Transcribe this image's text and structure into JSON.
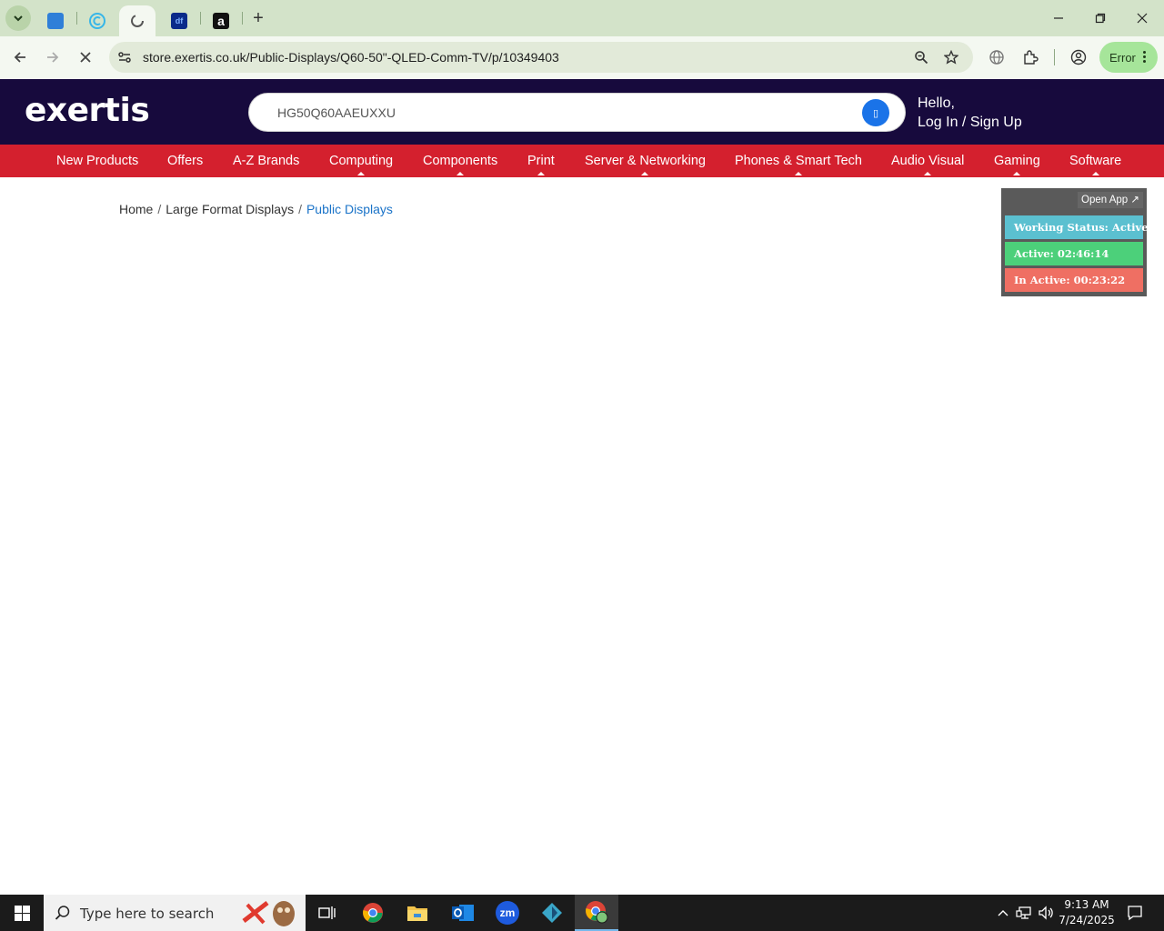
{
  "browser": {
    "tabs": [
      {
        "icon": "tab-favicon-blue-app"
      },
      {
        "icon": "tab-favicon-copyleaks"
      },
      {
        "icon": "tab-favicon-loading",
        "active": true
      },
      {
        "icon": "tab-favicon-df",
        "label": "df"
      },
      {
        "icon": "tab-favicon-amazon",
        "label": "a"
      }
    ],
    "new_tab_label": "+",
    "url": "store.exertis.co.uk/Public-Displays/Q60-50\"-QLED-Comm-TV/p/10349403",
    "error_label": "Error"
  },
  "site": {
    "logo": "exertis",
    "search_value": "HG50Q60AAEUXXU",
    "search_button_glyph": "▯",
    "hello": "Hello,",
    "login": "Log In / Sign Up",
    "nav": [
      {
        "label": "New Products"
      },
      {
        "label": "Offers"
      },
      {
        "label": "A-Z Brands"
      },
      {
        "label": "Computing"
      },
      {
        "label": "Components"
      },
      {
        "label": "Print"
      },
      {
        "label": "Server & Networking"
      },
      {
        "label": "Phones & Smart Tech"
      },
      {
        "label": "Audio Visual"
      },
      {
        "label": "Gaming"
      },
      {
        "label": "Software"
      }
    ],
    "breadcrumb": {
      "home": "Home",
      "sep": "/",
      "level1": "Large Format Displays",
      "current": "Public Displays"
    }
  },
  "widget": {
    "open_app": "Open App ↗",
    "status": "Working Status: Active",
    "active": "Active: 02:46:14",
    "inactive": "In Active: 00:23:22",
    "colors": {
      "status": "#5bc0d0",
      "active": "#4cd07a",
      "inactive": "#ef6f63"
    }
  },
  "taskbar": {
    "search_placeholder": "Type here to search",
    "apps": [
      "task-view",
      "chrome",
      "file-explorer",
      "outlook",
      "zoom",
      "app-diamond",
      "chrome-profile"
    ],
    "zoom_label": "zm",
    "time": "9:13 AM",
    "date": "7/24/2025"
  },
  "colors": {
    "header_bg": "#170a3d",
    "nav_bg": "#d4202e",
    "tabstrip_bg": "#d3e3c9",
    "toolbar_bg": "#f4f8f1",
    "link": "#1a73c8"
  }
}
